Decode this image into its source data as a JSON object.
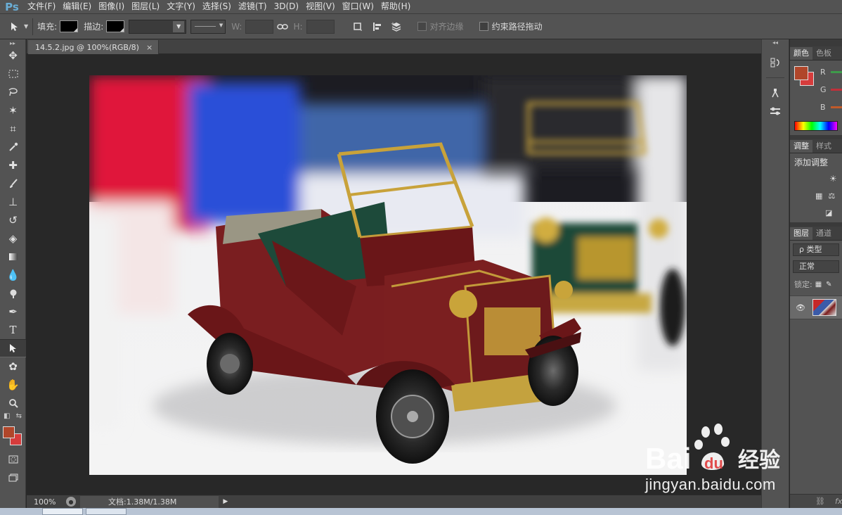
{
  "app": {
    "logo": "Ps"
  },
  "menu": [
    "文件(F)",
    "编辑(E)",
    "图像(I)",
    "图层(L)",
    "文字(Y)",
    "选择(S)",
    "滤镜(T)",
    "3D(D)",
    "视图(V)",
    "窗口(W)",
    "帮助(H)"
  ],
  "options": {
    "fill_label": "填充:",
    "stroke_label": "描边:",
    "w_label": "W:",
    "h_label": "H:",
    "align_edges_label": "对齐边缘",
    "constrain_path_label": "约束路径拖动"
  },
  "document": {
    "tab_label": "14.5.2.jpg @ 100%(RGB/8)",
    "close": "×"
  },
  "status": {
    "zoom": "100%",
    "doc_info": "文档:1.38M/1.38M"
  },
  "panels": {
    "color_tab": "颜色",
    "swatches_tab": "色板",
    "r_label": "R",
    "g_label": "G",
    "b_label": "B",
    "adjust_tab": "调整",
    "styles_tab": "样式",
    "add_adjust": "添加调整",
    "layers_tab": "图层",
    "channels_tab": "通道",
    "kind_label": "ρ 类型",
    "blend_mode": "正常",
    "lock_label": "锁定:"
  },
  "colors": {
    "foreground": "#b0462a",
    "background": "#d63c3c",
    "accent": "#6aaed6"
  },
  "watermark": {
    "brand": "Bai",
    "brand2": "du",
    "cn": "经验",
    "url": "jingyan.baidu.com"
  }
}
